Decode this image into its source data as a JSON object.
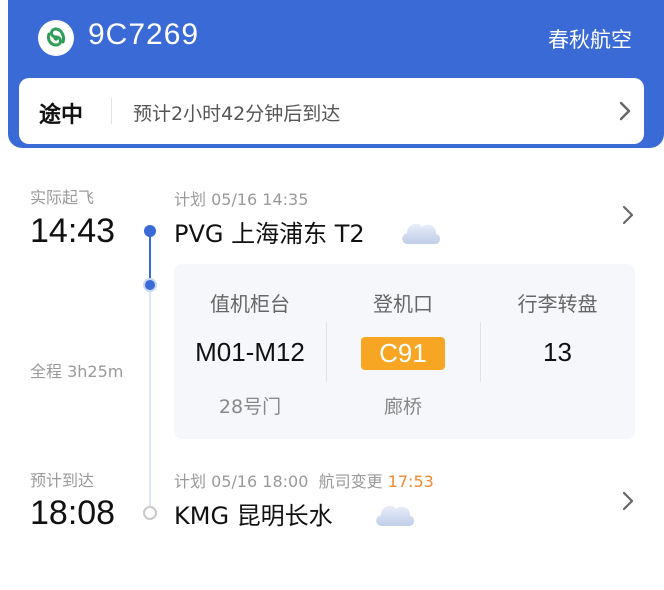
{
  "header": {
    "flight_no": "9C7269",
    "airline": "春秋航空",
    "status_label": "途中",
    "status_text": "预计2小时42分钟后到达"
  },
  "departure": {
    "label": "实际起飞",
    "time": "14:43",
    "plan": "计划 05/16 14:35",
    "airport": "PVG 上海浦东 T2",
    "weather_icon": "cloud-icon"
  },
  "duration": "全程 3h25m",
  "info": {
    "checkin": {
      "title": "值机柜台",
      "value": "M01-M12",
      "sub": "28号门"
    },
    "gate": {
      "title": "登机口",
      "value": "C91",
      "sub": "廊桥"
    },
    "baggage": {
      "title": "行李转盘",
      "value": "13"
    }
  },
  "arrival": {
    "label": "预计到达",
    "time": "18:08",
    "plan": "计划 05/16 18:00",
    "change_label": "航司变更",
    "new_time": "17:53",
    "airport": "KMG 昆明长水",
    "weather_icon": "cloud-icon"
  },
  "colors": {
    "primary": "#3a6ad6",
    "gate_badge": "#f6a623",
    "changed_time": "#f08a30"
  }
}
